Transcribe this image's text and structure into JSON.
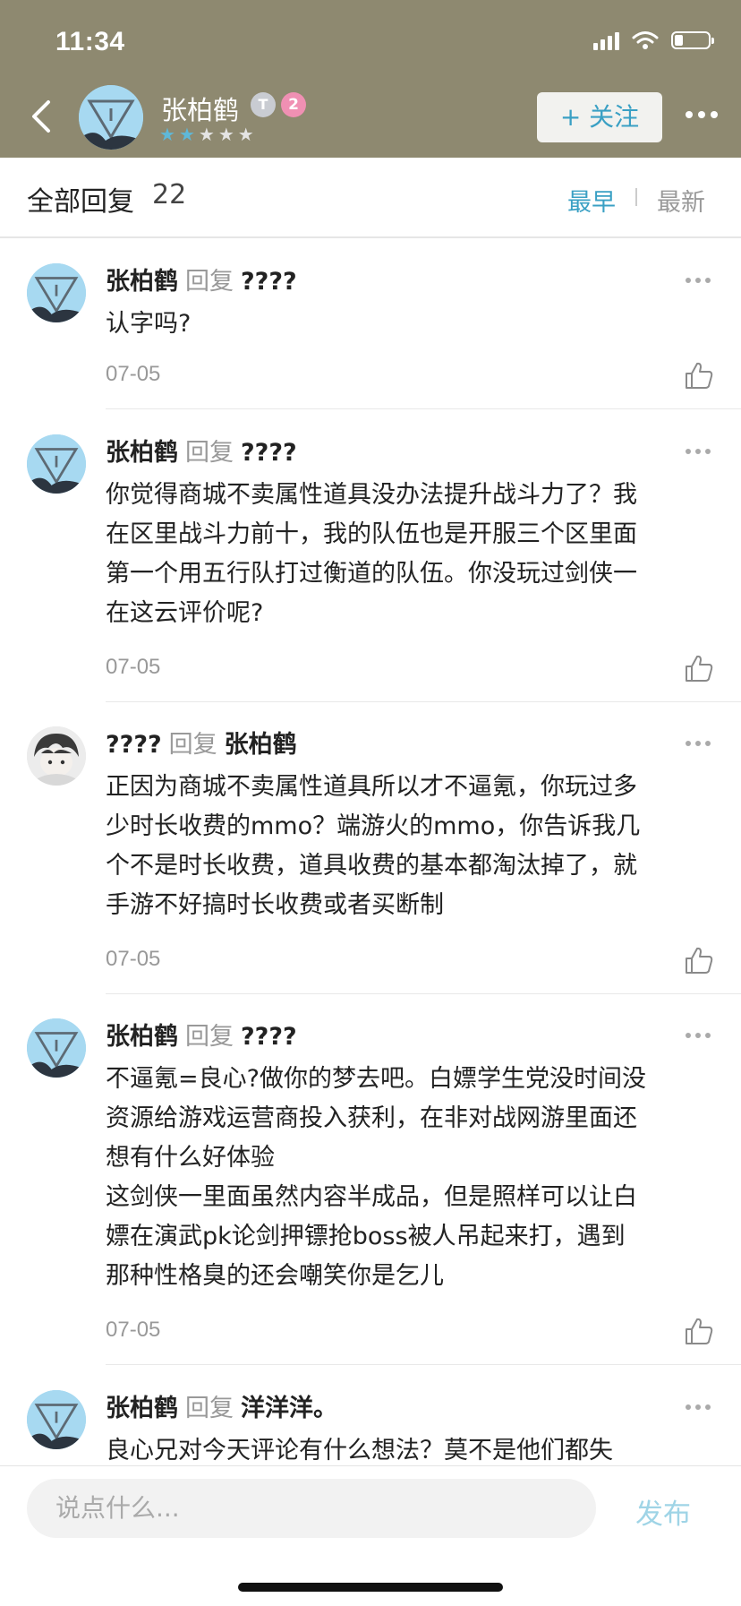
{
  "status": {
    "time": "11:34"
  },
  "header": {
    "name": "张柏鹤",
    "badge_t": "T",
    "badge_level": "2",
    "stars_on": 2,
    "stars_total": 5,
    "follow_label": "+ 关注",
    "colors": {
      "background": "#8e8970",
      "accent": "#3aa0c4"
    }
  },
  "subheader": {
    "title": "全部回复",
    "count": "22",
    "sort_earliest": "最早",
    "sort_newest": "最新",
    "active_sort": "最早"
  },
  "comments": [
    {
      "user": "张柏鹤",
      "reply": "回复",
      "target": "????",
      "text": "认字吗?",
      "date": "07-05"
    },
    {
      "user": "张柏鹤",
      "reply": "回复",
      "target": "????",
      "text": "你觉得商城不卖属性道具没办法提升战斗力了？我\n在区里战斗力前十，我的队伍也是开服三个区里面\n第一个用五行队打过衡道的队伍。你没玩过剑侠一\n在这云评价呢?",
      "date": "07-05"
    },
    {
      "user": "????",
      "reply": "回复",
      "target": "张柏鹤",
      "text": "正因为商城不卖属性道具所以才不逼氪，你玩过多\n少时长收费的mmo？端游火的mmo，你告诉我几\n个不是时长收费，道具收费的基本都淘汰掉了，就\n手游不好搞时长收费或者买断制",
      "date": "07-05"
    },
    {
      "user": "张柏鹤",
      "reply": "回复",
      "target": "????",
      "text": "不逼氪=良心?做你的梦去吧。白嫖学生党没时间没\n资源给游戏运营商投入获利，在非对战网游里面还\n想有什么好体验\n这剑侠一里面虽然内容半成品，但是照样可以让白\n嫖在演武pk论剑押镖抢boss被人吊起来打，遇到\n那种性格臭的还会嘲笑你是乞儿",
      "date": "07-05"
    },
    {
      "user": "张柏鹤",
      "reply": "回复",
      "target": "洋洋洋。",
      "text": "良心兄对今天评论有什么想法？莫不是他们都失",
      "date": ""
    }
  ],
  "bottom": {
    "placeholder": "说点什么...",
    "publish_label": "发布"
  }
}
